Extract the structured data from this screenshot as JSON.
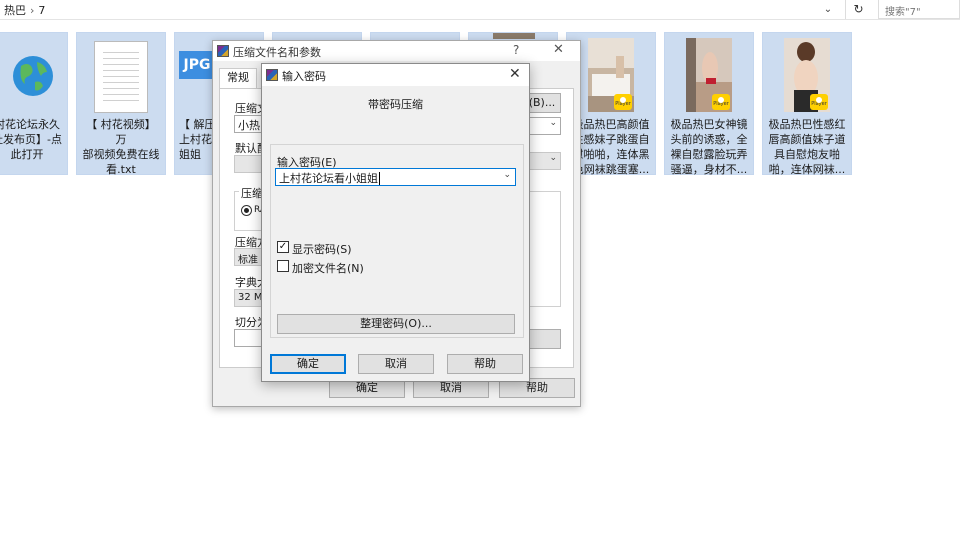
{
  "explorer": {
    "breadcrumb": [
      "热巴",
      "7"
    ],
    "search_placeholder": "搜索\"7\"",
    "items": [
      {
        "label": "村花论坛永久\n址发布页】-点\n此打开",
        "icon": "globe-icon"
      },
      {
        "label": "【 村花视频】万\n部视频免费在线\n看.txt",
        "icon": "text-file-icon"
      },
      {
        "label": "【 解压\n上村花\n姐姐",
        "icon": "jpg-file-icon",
        "icon_text": "JPG"
      },
      {
        "label": "",
        "icon": "file-icon"
      },
      {
        "label": "",
        "icon": "file-icon"
      },
      {
        "label": "",
        "icon": "image-icon"
      },
      {
        "label": "极品热巴高颜值\n性感妹子跳蛋自\n慰啪啪，连体黑\n色网袜跳蛋塞...",
        "icon": "video-thumbnail-icon"
      },
      {
        "label": "极品热巴女神镜\n头前的诱惑，全\n裸自慰露脸玩弄\n骚逼，身材不...",
        "icon": "video-thumbnail-icon"
      },
      {
        "label": "极品热巴性感红\n唇高颜值妹子道\n具自慰炮友啪\n啪，连体网袜...",
        "icon": "video-thumbnail-icon"
      }
    ],
    "badge_text": "Player"
  },
  "archive_dialog": {
    "title": "压缩文件名和参数",
    "tab_general": "常规",
    "label_archive_name": "压缩文",
    "archive_name_value": "小热巴",
    "label_default": "默认配",
    "label_format": "压缩",
    "radio_rar": "RA",
    "label_method": "压缩方",
    "method_value": "标准",
    "label_dict": "字典大",
    "dict_value": "32 MB",
    "label_split": "切分为",
    "browse_button": "(B)...",
    "ok_button": "确定",
    "cancel_button": "取消",
    "help_button": "帮助",
    "help_icon": "?",
    "close_icon": "✕"
  },
  "password_dialog": {
    "title": "输入密码",
    "header": "带密码压缩",
    "label_password": "输入密码(E)",
    "password_value": "上村花论坛看小姐姐",
    "show_password_label": "显示密码(S)",
    "show_password_checked": true,
    "encrypt_names_label": "加密文件名(N)",
    "encrypt_names_checked": false,
    "organize_button": "整理密码(O)...",
    "ok_button": "确定",
    "cancel_button": "取消",
    "help_button": "帮助",
    "close_icon": "✕"
  }
}
